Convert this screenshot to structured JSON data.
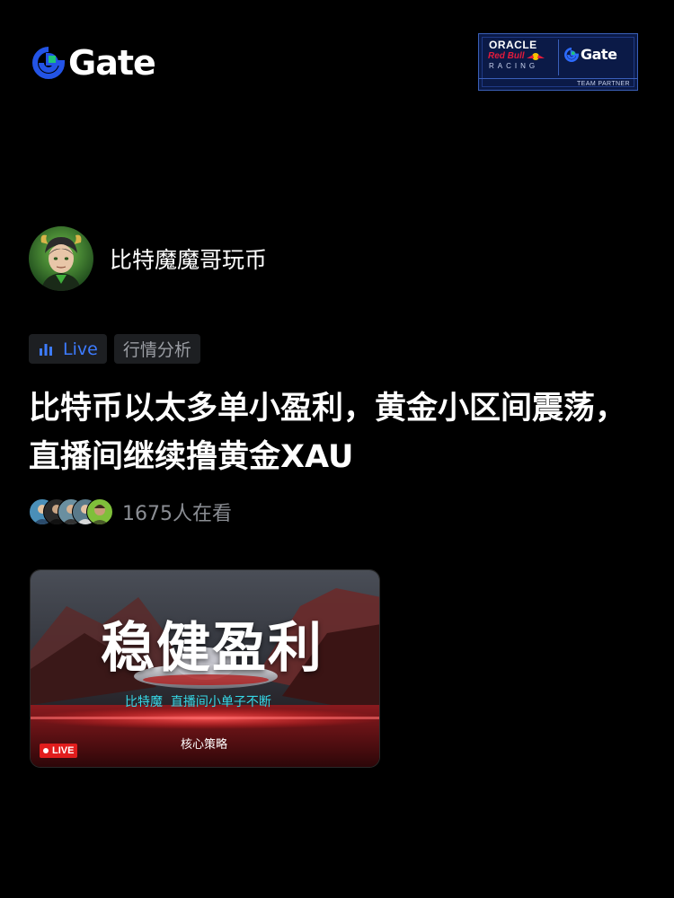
{
  "brand": {
    "logo_text": "Gate",
    "accent_color": "#2354e6",
    "accent_green": "#1fc37b"
  },
  "partner_badge": {
    "oracle": "ORACLE",
    "redbull": "Red Bull",
    "racing": "RACING",
    "gate": "Gate",
    "footer": "TEAM PARTNER"
  },
  "streamer": {
    "name": "比特魔魔哥玩币",
    "avatar_icon": "avatar-demon-character"
  },
  "tags": {
    "live_label": "Live",
    "live_icon": "bar-chart-icon",
    "category": "行情分析"
  },
  "stream": {
    "title": "比特币以太多单小盈利，黄金小区间震荡，直播间继续撸黄金XAU",
    "viewers_text": "1675人在看",
    "viewer_avatar_count": 5
  },
  "thumbnail": {
    "headline": "稳健盈利",
    "subtitle": "比特魔  直播间小单子不断",
    "caption": "核心策略",
    "live_badge": "LIVE"
  }
}
